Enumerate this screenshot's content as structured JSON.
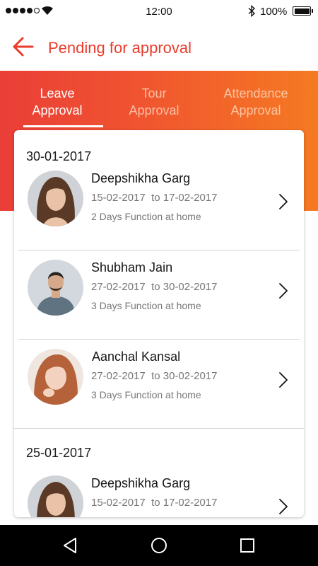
{
  "status_bar": {
    "time": "12:00",
    "battery_percent": "100%",
    "battery_level": 1.0,
    "signal_bars_filled": 4,
    "signal_bars_total": 5
  },
  "header": {
    "title": "Pending for approval",
    "back_icon": "arrow-left-icon",
    "accent_color": "#ea3b2c"
  },
  "tabs": [
    {
      "line1": "Leave",
      "line2": "Approval",
      "active": true
    },
    {
      "line1": "Tour",
      "line2": "Approval",
      "active": false
    },
    {
      "line1": "Attendance",
      "line2": "Approval",
      "active": false
    }
  ],
  "groups": [
    {
      "date": "30-01-2017",
      "items": [
        {
          "name": "Deepshikha Garg",
          "from": "15-02-2017",
          "to": "to 17-02-2017",
          "description": "2 Days Function at home",
          "avatar": "woman-portrait-avatar"
        },
        {
          "name": "Shubham Jain",
          "from": "27-02-2017",
          "to": "to 30-02-2017",
          "description": "3 Days Function at home",
          "avatar": "man-portrait-avatar"
        },
        {
          "name": "Aanchal Kansal",
          "from": "27-02-2017",
          "to": "to 30-02-2017",
          "description": "3 Days Function at home",
          "avatar": "woman-portrait-avatar"
        }
      ]
    },
    {
      "date": "25-01-2017",
      "items": [
        {
          "name": "Deepshikha Garg",
          "from": "15-02-2017",
          "to": "to 17-02-2017",
          "description": "",
          "avatar": "woman-portrait-avatar"
        }
      ]
    }
  ],
  "nav_bar": {
    "back": "triangle-back-icon",
    "home": "circle-home-icon",
    "recents": "square-recents-icon"
  }
}
